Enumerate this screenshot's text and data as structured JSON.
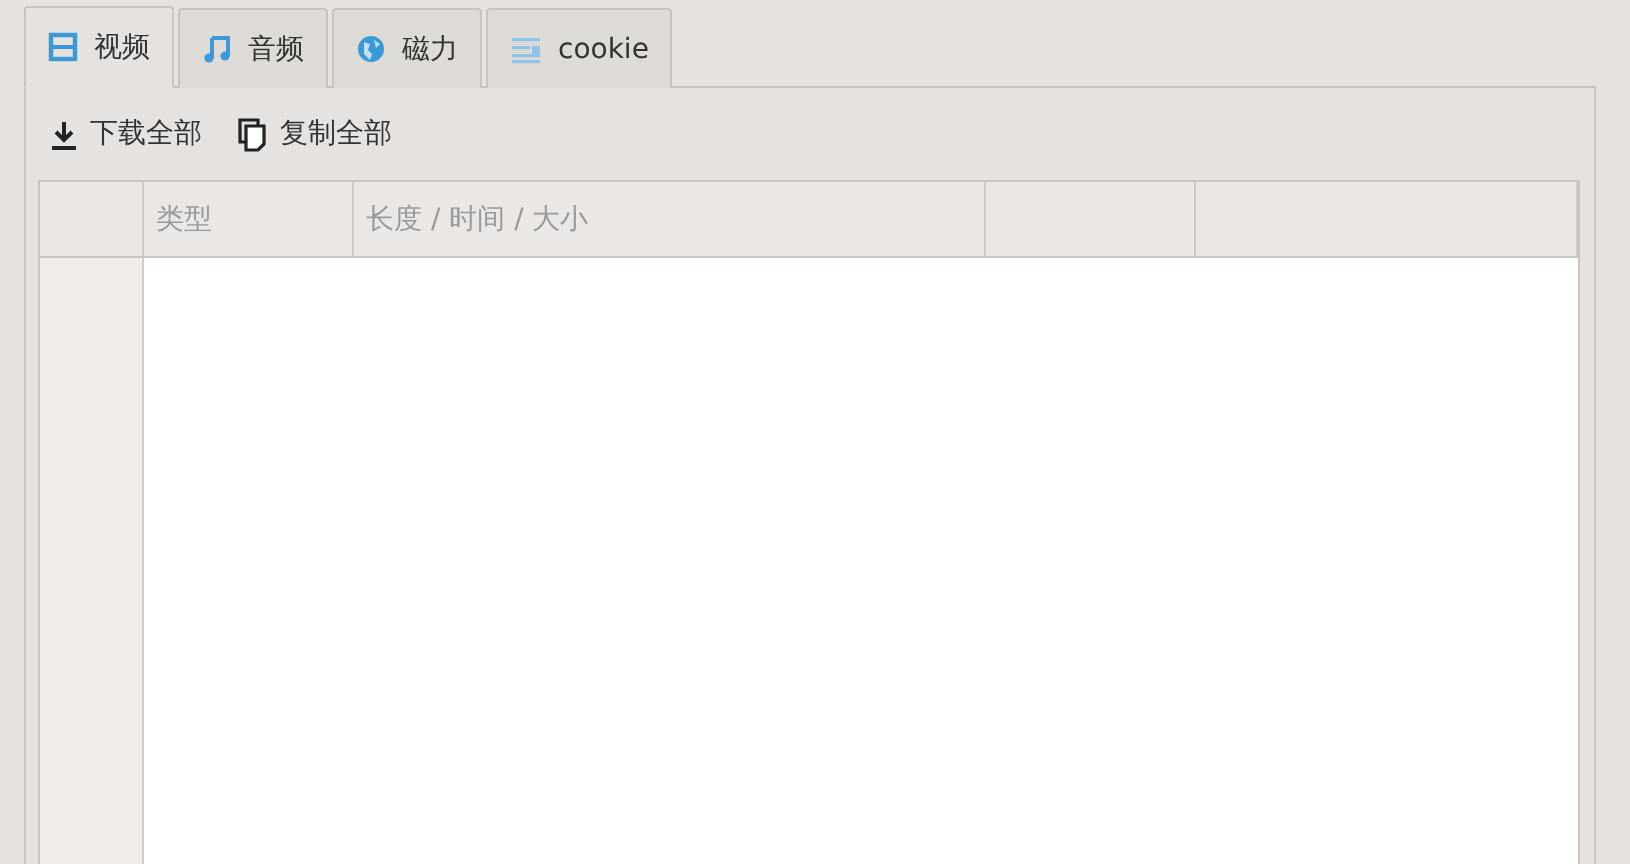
{
  "tabs": [
    {
      "label": "视频",
      "selected": true
    },
    {
      "label": "音频",
      "selected": false
    },
    {
      "label": "磁力",
      "selected": false
    },
    {
      "label": "cookie",
      "selected": false
    }
  ],
  "toolbar": [
    "下载全部",
    "复制全部"
  ],
  "table": {
    "columns": [
      "类型",
      "长度 / 时间 / 大小"
    ]
  }
}
